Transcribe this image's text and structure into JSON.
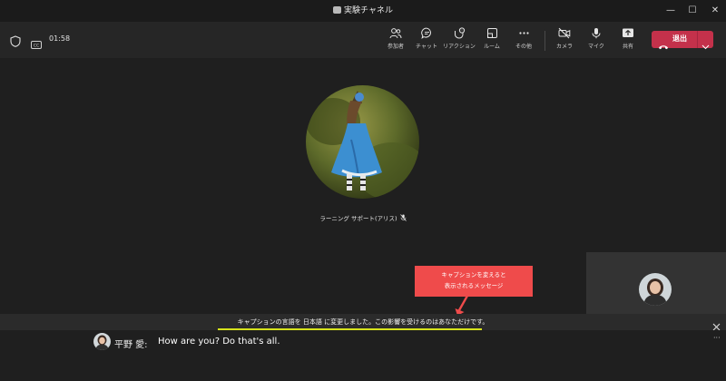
{
  "window": {
    "title": "実験チャネル",
    "controls": {
      "minimize": "—",
      "maximize": "☐",
      "close": "✕"
    }
  },
  "toolbar": {
    "timer": "01:58",
    "left_icons": [
      "shield-icon",
      "cc-icon"
    ],
    "items": [
      {
        "label": "参加者",
        "icon": "people-icon"
      },
      {
        "label": "チャット",
        "icon": "chat-icon"
      },
      {
        "label": "リアクション",
        "icon": "reaction-icon"
      },
      {
        "label": "ルーム",
        "icon": "rooms-icon"
      },
      {
        "label": "その他",
        "icon": "more-icon"
      },
      {
        "label": "カメラ",
        "icon": "camera-off-icon"
      },
      {
        "label": "マイク",
        "icon": "mic-icon"
      },
      {
        "label": "共有",
        "icon": "share-icon"
      }
    ],
    "leave_label": "退出",
    "leave_color": "#c4314b"
  },
  "stage": {
    "participant_name": "ラーニング サポート(アリス)",
    "participant_muted": true
  },
  "annotation": {
    "line1": "キャプションを変えると",
    "line2": "表示されるメッセージ",
    "color": "#ef4b4b",
    "underline_color": "#d6e21c"
  },
  "notification": {
    "message": "キャプションの言語を 日本語 に変更しました。この影響を受けるのはあなただけです。"
  },
  "caption": {
    "speaker": "平野 愛:",
    "text": "How are you? Do that's all.",
    "more": "···"
  }
}
